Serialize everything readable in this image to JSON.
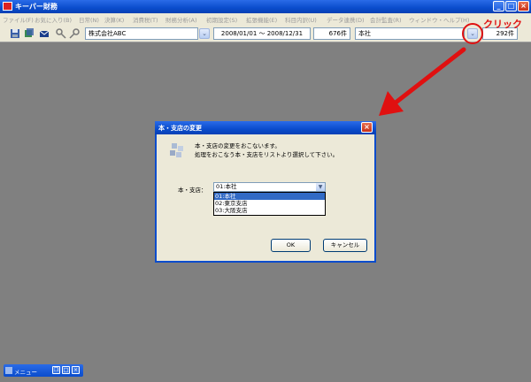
{
  "window": {
    "title": "キーパー財務"
  },
  "menu": [
    "ファイル(F)",
    "お気に入り(B)",
    "日常(N)",
    "決算(K)",
    "消費税(T)",
    "財務分析(A)",
    "初期設定(S)",
    "拡張機能(E)",
    "科目内訳(U)",
    "データ連携(D)",
    "会計監査(R)",
    "ウィンドウ・ヘルプ(H)"
  ],
  "toolbar": {
    "company": "株式会社ABC",
    "period": "2008/01/01 ～ 2008/12/31",
    "entry_count": "676件",
    "branch": "本社",
    "branch_count": "292件"
  },
  "annotation": {
    "label": "クリック",
    "color": "#e01010"
  },
  "dialog": {
    "title": "本・支店の変更",
    "message_line1": "本・支店の変更をおこないます。",
    "message_line2": "処理をおこなう本・支店をリストより選択して下さい。",
    "field_label": "本・支店：",
    "selected_value": "01:本社",
    "options": [
      "01:本社",
      "02:東京支店",
      "03:大阪支店"
    ],
    "ok_label": "OK",
    "cancel_label": "キャンセル"
  },
  "minimized_window": {
    "title": "メニュー"
  },
  "colors": {
    "titlebar": "#0a4ccc",
    "selection": "#316ac5",
    "workspace": "#808080"
  }
}
